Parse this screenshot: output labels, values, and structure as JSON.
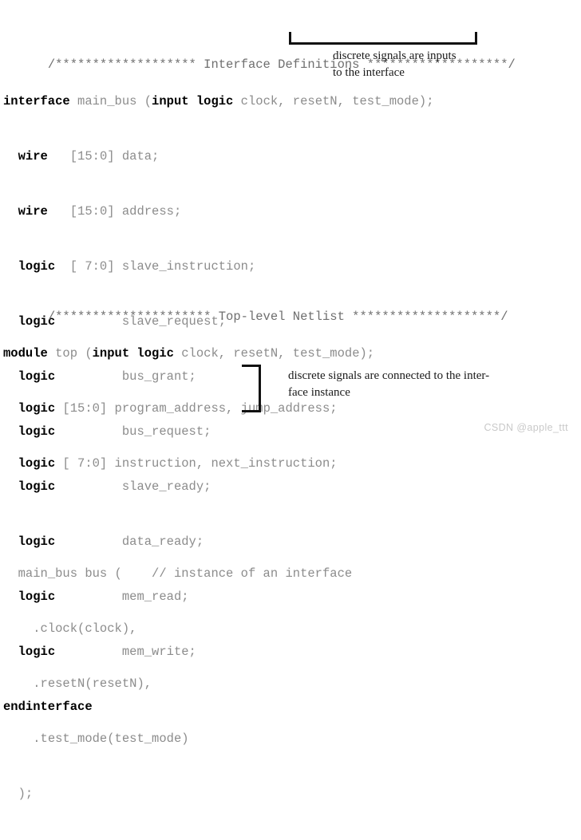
{
  "document": {
    "kind": "systemverilog-code-figure",
    "language": "SystemVerilog"
  },
  "colors": {
    "background": "#ffffff",
    "keyword": "#000000",
    "identifier": "#8c8c8c",
    "banner": "#6f6f6f",
    "annotation": "#1a1a1a",
    "bracket": "#111111",
    "watermark": "#c9c9c9"
  },
  "interface_block": {
    "banner": "/******************* Interface Definitions *******************/",
    "lines": [
      {
        "keyword": "interface",
        "rest": " main_bus (",
        "keyword2": "input logic",
        "rest2": " clock, resetN, test_mode);"
      },
      {
        "indent": "  ",
        "keyword": "wire",
        "rest": "   [15:0] data;"
      },
      {
        "indent": "  ",
        "keyword": "wire",
        "rest": "   [15:0] address;"
      },
      {
        "indent": "  ",
        "keyword": "logic",
        "rest": "  [ 7:0] slave_instruction;"
      },
      {
        "indent": "  ",
        "keyword": "logic",
        "rest": "         slave_request;"
      },
      {
        "indent": "  ",
        "keyword": "logic",
        "rest": "         bus_grant;"
      },
      {
        "indent": "  ",
        "keyword": "logic",
        "rest": "         bus_request;"
      },
      {
        "indent": "  ",
        "keyword": "logic",
        "rest": "         slave_ready;"
      },
      {
        "indent": "  ",
        "keyword": "logic",
        "rest": "         data_ready;"
      },
      {
        "indent": "  ",
        "keyword": "logic",
        "rest": "         mem_read;"
      },
      {
        "indent": "  ",
        "keyword": "logic",
        "rest": "         mem_write;"
      },
      {
        "indent": "",
        "keyword": "endinterface",
        "rest": ""
      }
    ]
  },
  "netlist_block": {
    "banner": "/********************* Top-level Netlist ********************/",
    "lines": [
      {
        "keyword": "module",
        "rest": " top (",
        "keyword2": "input logic",
        "rest2": " clock, resetN, test_mode);"
      },
      {
        "indent": "  ",
        "keyword": "logic",
        "rest": " [15:0] program_address, jump_address;"
      },
      {
        "indent": "  ",
        "keyword": "logic",
        "rest": " [ 7:0] instruction, next_instruction;"
      },
      {
        "indent": "",
        "keyword": "",
        "rest": ""
      },
      {
        "indent": "  ",
        "keyword": "",
        "rest": "main_bus bus (    // instance of an interface"
      },
      {
        "indent": "    ",
        "keyword": "",
        "rest": ".clock(clock),"
      },
      {
        "indent": "    ",
        "keyword": "",
        "rest": ".resetN(resetN),"
      },
      {
        "indent": "    ",
        "keyword": "",
        "rest": ".test_mode(test_mode)"
      },
      {
        "indent": "  ",
        "keyword": "",
        "rest": ");"
      }
    ]
  },
  "annotations": {
    "inputs": "discrete signals are inputs\nto the interface",
    "connected": "discrete signals are connected to the inter-\nface instance"
  },
  "watermark": {
    "text": "CSDN @apple_ttt"
  }
}
